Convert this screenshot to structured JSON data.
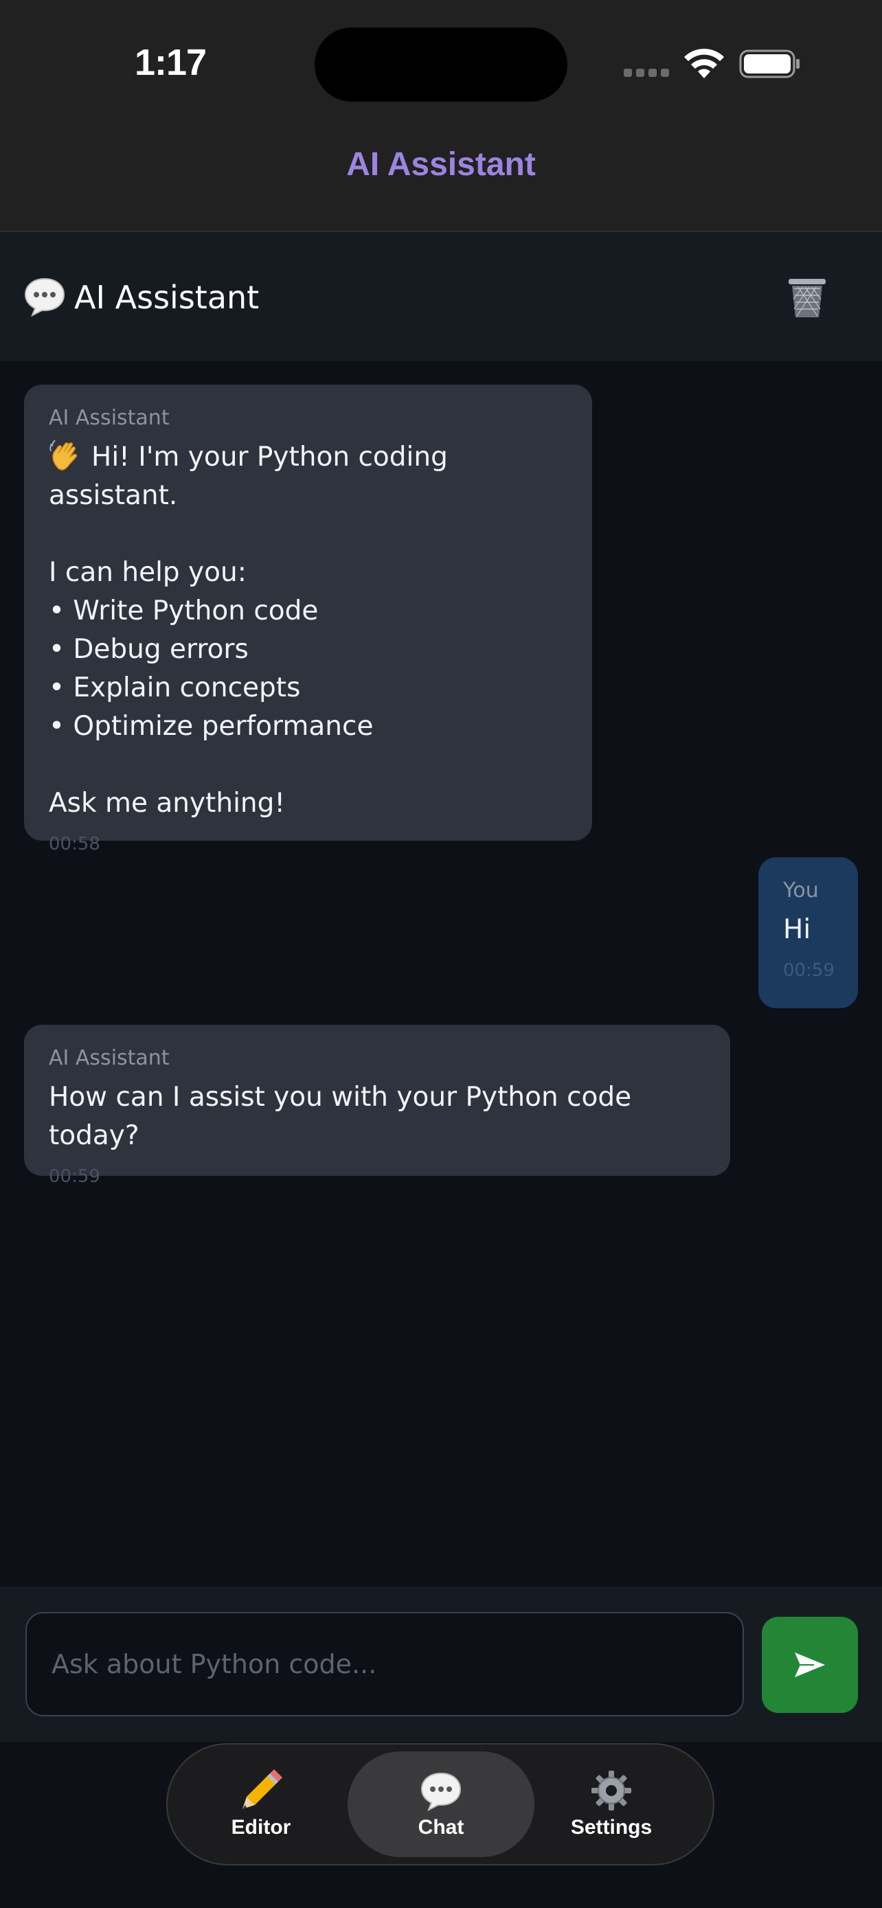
{
  "status_bar": {
    "time": "1:17"
  },
  "nav": {
    "title": "AI Assistant"
  },
  "chat_header": {
    "title": "AI Assistant"
  },
  "messages": [
    {
      "sender": "AI Assistant",
      "greeting": "Hi! I'm your Python coding assistant.",
      "text": "I can help you:\n• Write Python code\n• Debug errors\n• Explain concepts\n• Optimize performance\n\nAsk me anything!",
      "time": "00:58"
    },
    {
      "sender": "You",
      "text": "Hi",
      "time": "00:59"
    },
    {
      "sender": "AI Assistant",
      "text": "How can I assist you with your Python code today?",
      "time": "00:59"
    }
  ],
  "composer": {
    "placeholder": "Ask about Python code..."
  },
  "tabs": [
    {
      "label": "Editor",
      "icon": "pencil-icon"
    },
    {
      "label": "Chat",
      "icon": "chat-bubble-icon",
      "active": true
    },
    {
      "label": "Settings",
      "icon": "gear-icon"
    }
  ],
  "colors": {
    "accent": "#9d84e0",
    "send_button": "#228636",
    "user_bubble": "#1b3a5e",
    "ai_bubble": "#2e333e"
  }
}
